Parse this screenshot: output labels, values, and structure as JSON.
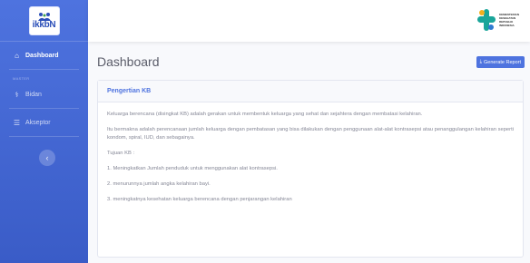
{
  "brand": {
    "logo_text": "ikkbN"
  },
  "sidebar": {
    "items": [
      {
        "label": "Dashboard",
        "icon": "home-icon",
        "glyph": "⌂"
      },
      {
        "label": "Bidan",
        "icon": "user-icon",
        "glyph": "⚕"
      },
      {
        "label": "Akseptor",
        "icon": "list-icon",
        "glyph": "☰"
      }
    ],
    "heading": "MASTER",
    "toggle_glyph": "‹"
  },
  "topbar": {
    "org_lines": [
      "KEMENTERIAN",
      "KESEHATAN",
      "REPUBLIK",
      "INDONESIA"
    ]
  },
  "main": {
    "title": "Dashboard",
    "report_button": "Generate Report",
    "report_glyph": "⤓"
  },
  "card": {
    "title": "Pengertian KB",
    "paragraphs": [
      "Keluarga berencana (disingkat KB) adalah gerakan untuk membentuk keluarga yang sehat dan sejahtera dengan membatasi kelahiran.",
      "Itu bermakna adalah perencanaan jumlah keluarga dengan pembatasan yang bisa dilakukan dengan penggunaan alat-alat kontrasepsi atau penanggulangan kelahiran seperti kondom, spiral, IUD, dan sebagainya.",
      "Tujuan KB :",
      "1. Meningkatkan Jumlah penduduk untuk menggunakan alat kontrasepsi.",
      "2. menurunnya jumlah angka kelahiran bayi.",
      "3. meningkatnya kesehatan keluarga berencana dengan penjarangan kelahiran"
    ]
  },
  "colors": {
    "primary": "#4e73df",
    "text_muted": "#858796",
    "title_text": "#5a5c69"
  }
}
